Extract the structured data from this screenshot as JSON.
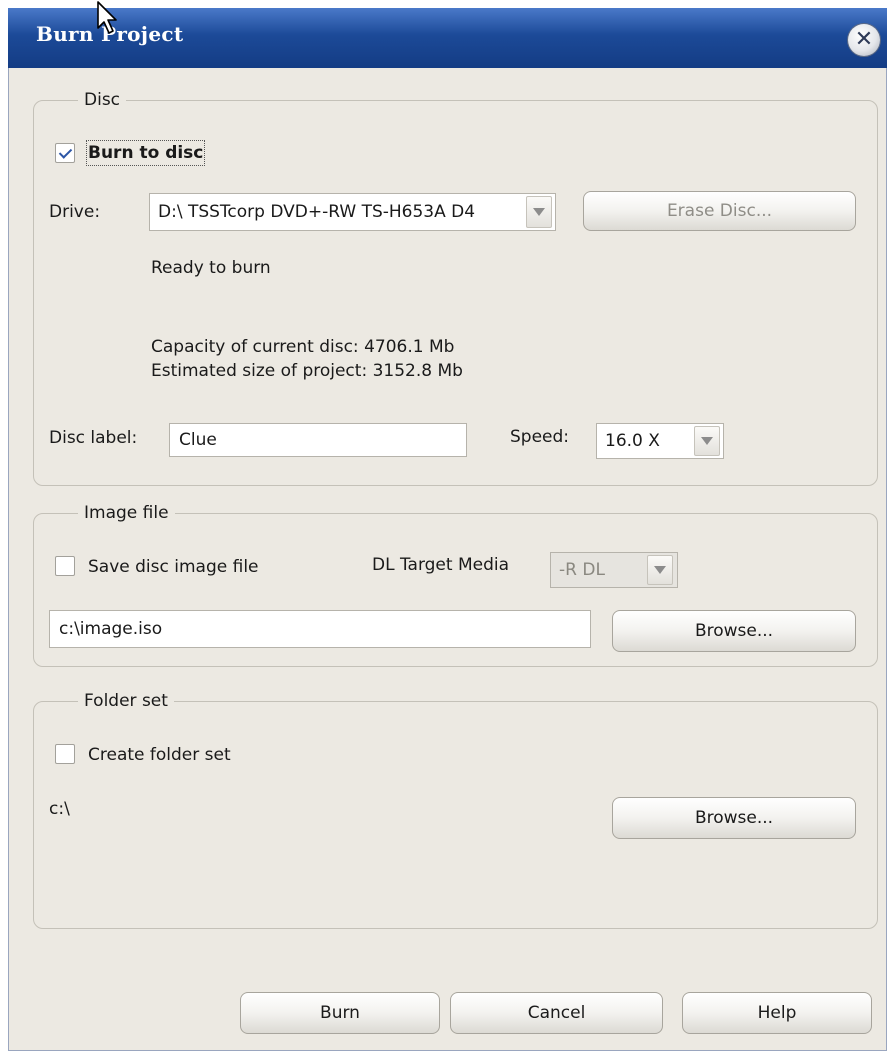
{
  "window": {
    "title": "Burn Project"
  },
  "disc": {
    "legend": "Disc",
    "burn_to_disc_label": "Burn to disc",
    "burn_to_disc_checked": true,
    "drive_label": "Drive:",
    "drive_value": "D:\\ TSSTcorp DVD+-RW TS-H653A D4",
    "erase_button": "Erase Disc...",
    "status": "Ready to burn",
    "capacity": "Capacity of current disc: 4706.1 Mb",
    "estimated_size": "Estimated size of project: 3152.8 Mb",
    "disc_label_label": "Disc label:",
    "disc_label_value": "Clue",
    "speed_label": "Speed:",
    "speed_value": "16.0 X"
  },
  "image_file": {
    "legend": "Image file",
    "save_image_label": "Save disc image file",
    "save_image_checked": false,
    "dl_target_label": "DL Target Media",
    "dl_target_value": "-R DL",
    "path_value": "c:\\image.iso",
    "browse_button": "Browse..."
  },
  "folder_set": {
    "legend": "Folder set",
    "create_label": "Create folder set",
    "create_checked": false,
    "path": "c:\\",
    "browse_button": "Browse..."
  },
  "footer": {
    "burn_button": "Burn",
    "cancel_button": "Cancel",
    "help_button": "Help"
  }
}
